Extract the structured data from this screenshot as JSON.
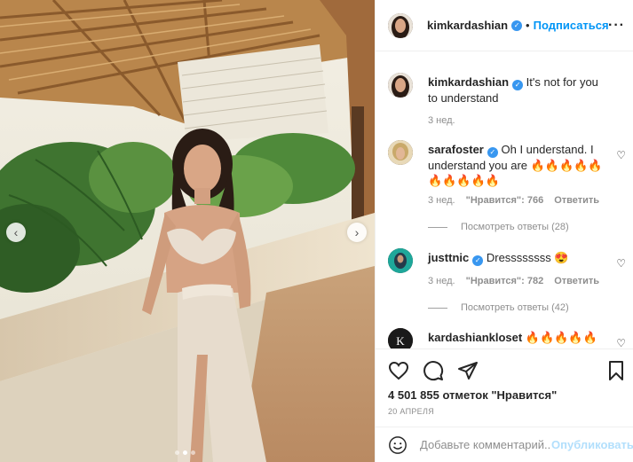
{
  "post": {
    "author": "kimkardashian",
    "follow_label": "Подписаться",
    "more_label": "···",
    "caption": {
      "author": "kimkardashian",
      "text": "It's not for you to understand",
      "time": "3 нед."
    }
  },
  "comments": [
    {
      "user": "sarafoster",
      "text": "Oh I understand. I understand you are 🔥🔥🔥🔥🔥 🔥🔥🔥🔥🔥",
      "time": "3 нед.",
      "likes": "\"Нравится\": 766",
      "reply_label": "Ответить",
      "view_replies": "Посмотреть ответы (28)"
    },
    {
      "user": "justtnic",
      "text": "Dressssssss 😍",
      "time": "3 нед.",
      "likes": "\"Нравится\": 782",
      "reply_label": "Ответить",
      "view_replies": "Посмотреть ответы (42)"
    },
    {
      "user": "kardashiankloset",
      "text": "🔥🔥🔥🔥🔥"
    }
  ],
  "actions": {
    "likes_count": "4 501 855 отметок \"Нравится\"",
    "date": "20 АПРЕЛЯ"
  },
  "add_comment": {
    "placeholder": "Добавьте комментарий...",
    "publish_label": "Опубликовать"
  },
  "carousel": {
    "slide_count": 3,
    "active_slide": 2
  },
  "colors": {
    "accent": "#0095f6",
    "verified": "#3897f0",
    "muted": "#8e8e8e",
    "publish_disabled": "#b2dffc"
  },
  "icons": [
    "chevron-left-icon",
    "chevron-right-icon",
    "heart-icon",
    "comment-icon",
    "share-icon",
    "bookmark-icon",
    "emoji-icon",
    "verified-icon",
    "more-icon"
  ]
}
